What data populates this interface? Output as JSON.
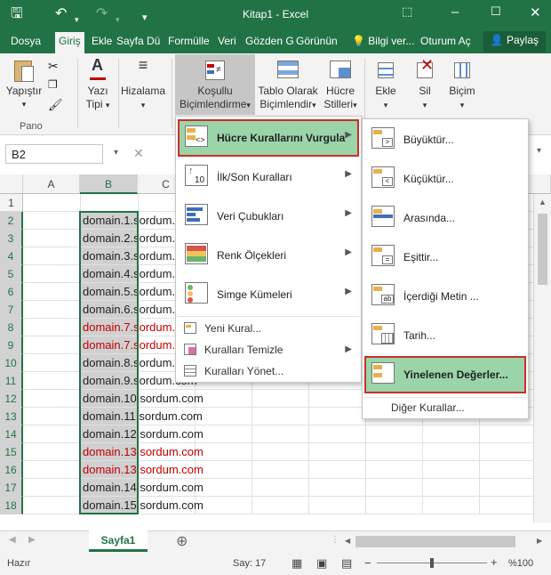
{
  "window": {
    "title": "Kitap1 - Excel"
  },
  "tabs": [
    "Dosya",
    "Giriş",
    "Ekle",
    "Sayfa Dü",
    "Formülle",
    "Veri",
    "Gözden G",
    "Görünün"
  ],
  "active_tab": "Giriş",
  "tell_me": "Bilgi ver...",
  "sign_in": "Oturum Aç",
  "share": "Paylaş",
  "ribbon": {
    "paste": "Yapıştır",
    "clipboard_group": "Pano",
    "font_line1": "Yazı",
    "font_line2": "Tipi",
    "alignment": "Hizalama",
    "cond_line1": "Koşullu",
    "cond_line2": "Biçimlendirme",
    "table_line1": "Tablo Olarak",
    "table_line2": "Biçimlendir",
    "cellstyles_line1": "Hücre",
    "cellstyles_line2": "Stilleri",
    "insert": "Ekle",
    "delete": "Sil",
    "format": "Biçim"
  },
  "name_box": "B2",
  "columns": [
    "A",
    "B",
    "C"
  ],
  "rows": [
    "1",
    "2",
    "3",
    "4",
    "5",
    "6",
    "7",
    "8",
    "9",
    "10",
    "11",
    "12",
    "13",
    "14",
    "15",
    "16",
    "17",
    "18"
  ],
  "cells": [
    {
      "text": "domain.1.sordum.com",
      "dup": false
    },
    {
      "text": "domain.2.sordum.com",
      "dup": false
    },
    {
      "text": "domain.3.sordum.com",
      "dup": false
    },
    {
      "text": "domain.4.sordum.com",
      "dup": false
    },
    {
      "text": "domain.5.sordum.com",
      "dup": false
    },
    {
      "text": "domain.6.sordum.com",
      "dup": false
    },
    {
      "text": "domain.7.sordum.com",
      "dup": true
    },
    {
      "text": "domain.7.sordum.com",
      "dup": true
    },
    {
      "text": "domain.8.sordum.com",
      "dup": false
    },
    {
      "text": "domain.9.sordum.com",
      "dup": false
    },
    {
      "text": "domain.10.sordum.com",
      "dup": false
    },
    {
      "text": "domain.11.sordum.com",
      "dup": false
    },
    {
      "text": "domain.12.sordum.com",
      "dup": false
    },
    {
      "text": "domain.13.sordum.com",
      "dup": true
    },
    {
      "text": "domain.13.sordum.com",
      "dup": true
    },
    {
      "text": "domain.14.sordum.com",
      "dup": false
    },
    {
      "text": "domain.15.sordum.com",
      "dup": false
    }
  ],
  "cf_menu": {
    "highlight": "Hücre Kurallarını Vurgula",
    "topbottom": "İlk/Son Kuralları",
    "databars": "Veri Çubukları",
    "colorscales": "Renk Ölçekleri",
    "iconsets": "Simge Kümeleri",
    "new_rule": "Yeni Kural...",
    "clear_rules": "Kuralları Temizle",
    "manage_rules": "Kuralları Yönet..."
  },
  "hc_menu": {
    "greater": "Büyüktür...",
    "less": "Küçüktür...",
    "between": "Arasında...",
    "equal": "Eşittir...",
    "contains": "İçerdiği Metin ...",
    "date": "Tarih...",
    "duplicates": "Yinelenen Değerler...",
    "more_rules": "Diğer Kurallar..."
  },
  "sheet_tab": "Sayfa1",
  "status": {
    "ready": "Hazır",
    "count": "Say: 17",
    "zoom": "%100"
  },
  "colors": {
    "accent": "#217346",
    "duplicate_text": "#c00000",
    "hover": "#9ad4a8",
    "callout": "#c8302a"
  }
}
